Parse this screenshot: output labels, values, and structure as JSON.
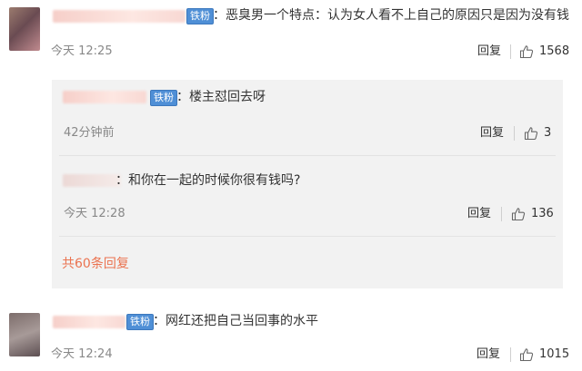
{
  "comments": [
    {
      "badge": "铁粉",
      "text": "：恶臭男一个特点：认为女人看不上自己的原因只是因为没有钱",
      "time": "今天 12:25",
      "reply_label": "回复",
      "likes": "1568"
    },
    {
      "badge": "铁粉",
      "text": "：网红还把自己当回事的水平",
      "time": "今天 12:24",
      "reply_label": "回复",
      "likes": "1015"
    }
  ],
  "sub_replies": [
    {
      "badge": "铁粉",
      "text": "：楼主怼回去呀",
      "time": "42分钟前",
      "reply_label": "回复",
      "likes": "3"
    },
    {
      "text": "：和你在一起的时候你很有钱吗?",
      "time": "今天 12:28",
      "reply_label": "回复",
      "likes": "136"
    }
  ],
  "more_replies": "共60条回复",
  "colors": {
    "badge": "#4f8fd6",
    "more_link": "#eb7350",
    "subbox": "#f2f2f2"
  },
  "icons": {
    "like": "thumbs-up-icon"
  }
}
